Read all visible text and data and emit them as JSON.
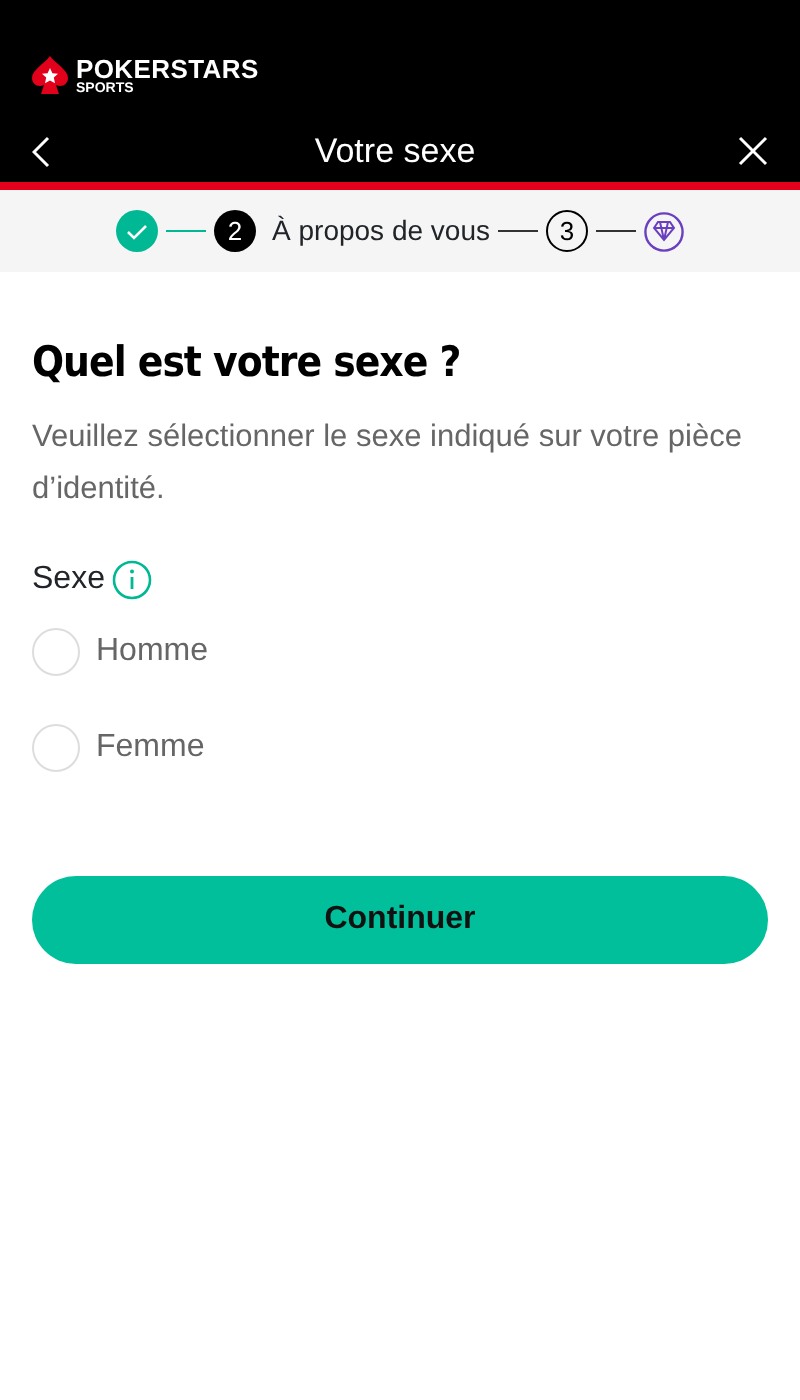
{
  "brand": {
    "name": "POKERSTARS",
    "sub": "SPORTS"
  },
  "header": {
    "title": "Votre sexe"
  },
  "steps": [
    {
      "kind": "done"
    },
    {
      "kind": "current",
      "number": "2",
      "label": "À propos de vous"
    },
    {
      "kind": "upcoming",
      "number": "3"
    },
    {
      "kind": "final"
    }
  ],
  "heading": "Quel est votre sexe ?",
  "description": "Veuillez sélectionner le sexe indiqué sur votre pièce d’identité.",
  "field_label": "Sexe",
  "options": [
    {
      "label": "Homme",
      "selected": false
    },
    {
      "label": "Femme",
      "selected": false
    }
  ],
  "button": "Continuer"
}
